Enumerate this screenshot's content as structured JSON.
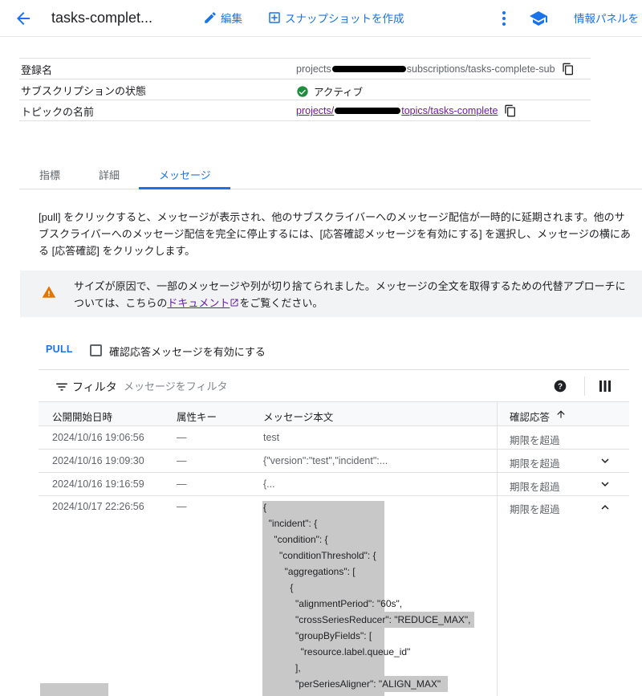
{
  "header": {
    "title": "tasks-complet...",
    "edit_label": "編集",
    "snapshot_label": "スナップショットを作成",
    "info_panel_label": "情報パネルを"
  },
  "info": {
    "rows": [
      {
        "label": "登録名",
        "value_prefix": "projects",
        "value_suffix": "subscriptions/tasks-complete-sub"
      },
      {
        "label": "サブスクリプションの状態",
        "value": "アクティブ"
      },
      {
        "label": "トピックの名前",
        "value_prefix": "projects/",
        "value_suffix": "topics/tasks-complete"
      }
    ]
  },
  "tabs": [
    "指標",
    "詳細",
    "メッセージ"
  ],
  "active_tab": "メッセージ",
  "description": "[pull] をクリックすると、メッセージが表示され、他のサブスクライバーへのメッセージ配信が一時的に延期されます。他のサブスクライバーへのメッセージ配信を完全に停止するには、[応答確認メッセージを有効にする] を選択し、メッセージの横にある [応答確認] をクリックします。",
  "warning": {
    "text_before": "サイズが原因で、一部のメッセージや列が切り捨てられました。メッセージの全文を取得するための代替アプローチについては、こちらの",
    "link": "ドキュメント",
    "text_after": "をご覧ください。"
  },
  "pull_button": "PULL",
  "ack_checkbox_label": "確認応答メッセージを有効にする",
  "ack_checked": false,
  "filter": {
    "label": "フィルタ",
    "placeholder": "メッセージをフィルタ"
  },
  "table": {
    "headers": [
      "公開開始日時",
      "属性キー",
      "メッセージ本文",
      "確認応答"
    ],
    "rows": [
      {
        "date": "2024/10/16 19:06:56",
        "attr": "—",
        "body": "test",
        "ack": "期限を超過"
      },
      {
        "date": "2024/10/16 19:09:30",
        "attr": "—",
        "body": "{\"version\":\"test\",\"incident\":...",
        "ack": "期限を超過"
      },
      {
        "date": "2024/10/16 19:16:59",
        "attr": "—",
        "body": "{...",
        "ack": "期限を超過"
      },
      {
        "date": "2024/10/17 22:26:56",
        "attr": "—",
        "body": "{",
        "ack": "期限を超過"
      }
    ],
    "expanded_json_lines": [
      "  \"incident\": {",
      "    \"condition\": {",
      "      \"conditionThreshold\": {",
      "        \"aggregations\": [",
      "          {",
      "            \"alignmentPeriod\": \"60s\",",
      "            \"crossSeriesReducer\": \"REDUCE_MAX\",",
      "            \"groupByFields\": [",
      "              \"resource.label.queue_id\"",
      "            ],",
      "            \"perSeriesAligner\": \"ALIGN_MAX\""
    ]
  },
  "colors": {
    "accent": "#1a73e8",
    "link": "#681da8",
    "success": "#1e8e3e",
    "warning": "#e37400"
  }
}
